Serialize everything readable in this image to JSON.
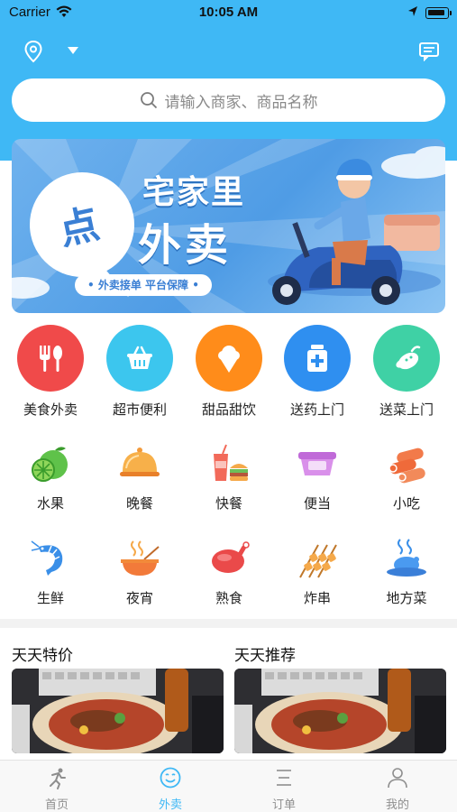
{
  "status_bar": {
    "carrier": "Carrier",
    "time": "10:05 AM"
  },
  "search": {
    "placeholder": "请输入商家、商品名称"
  },
  "banner": {
    "badge": "点",
    "title_line1": "宅家里",
    "title_line2": "外卖",
    "tagline": "• 外卖接单  平台保障 •"
  },
  "categories": [
    {
      "label": "美食外卖",
      "icon": "fork-spoon-icon",
      "color": "#f04a4a"
    },
    {
      "label": "超市便利",
      "icon": "basket-icon",
      "color": "#3cc6ee"
    },
    {
      "label": "甜品甜饮",
      "icon": "ice-cream-icon",
      "color": "#ff8c1a"
    },
    {
      "label": "送药上门",
      "icon": "medicine-icon",
      "color": "#2f8ff0"
    },
    {
      "label": "送菜上门",
      "icon": "vegetable-icon",
      "color": "#3fd1a5"
    }
  ],
  "subcategories": [
    {
      "label": "水果",
      "icon": "fruit-icon"
    },
    {
      "label": "晚餐",
      "icon": "dinner-cloche-icon"
    },
    {
      "label": "快餐",
      "icon": "fast-food-icon"
    },
    {
      "label": "便当",
      "icon": "bento-icon"
    },
    {
      "label": "小吃",
      "icon": "snack-roll-icon"
    },
    {
      "label": "生鲜",
      "icon": "shrimp-icon"
    },
    {
      "label": "夜宵",
      "icon": "noodle-bowl-icon"
    },
    {
      "label": "熟食",
      "icon": "roast-chicken-icon"
    },
    {
      "label": "炸串",
      "icon": "skewer-icon"
    },
    {
      "label": "地方菜",
      "icon": "local-dish-icon"
    }
  ],
  "sections": {
    "daily_deals": "天天特价",
    "daily_picks": "天天推荐"
  },
  "tabbar": [
    {
      "label": "首页",
      "icon": "runner-icon",
      "active": false
    },
    {
      "label": "外卖",
      "icon": "smile-icon",
      "active": true
    },
    {
      "label": "订单",
      "icon": "list-icon",
      "active": false
    },
    {
      "label": "我的",
      "icon": "user-icon",
      "active": false
    }
  ],
  "colors": {
    "brand": "#3fb8f5",
    "tab_inactive": "#8e8e8e"
  }
}
